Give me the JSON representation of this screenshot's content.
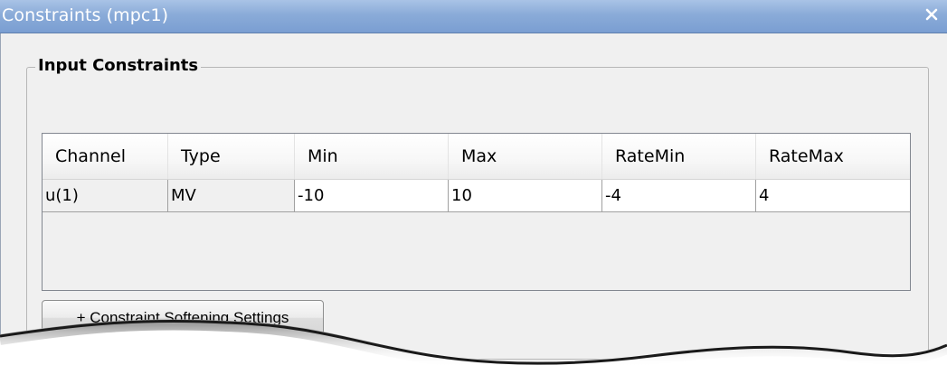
{
  "window": {
    "title": "Constraints (mpc1)",
    "close_icon": "close-icon"
  },
  "group": {
    "title": "Input Constraints"
  },
  "table": {
    "columns": [
      "Channel",
      "Type",
      "Min",
      "Max",
      "RateMin",
      "RateMax"
    ],
    "rows": [
      [
        "u(1)",
        "MV",
        "-10",
        "10",
        "-4",
        "4"
      ]
    ]
  },
  "softening_button": {
    "label": "+ Constraint Softening Settings"
  },
  "colors": {
    "titlebar": "#8aabd8",
    "dialog_bg": "#f0f0f0",
    "editable_cell": "#ffffff"
  }
}
